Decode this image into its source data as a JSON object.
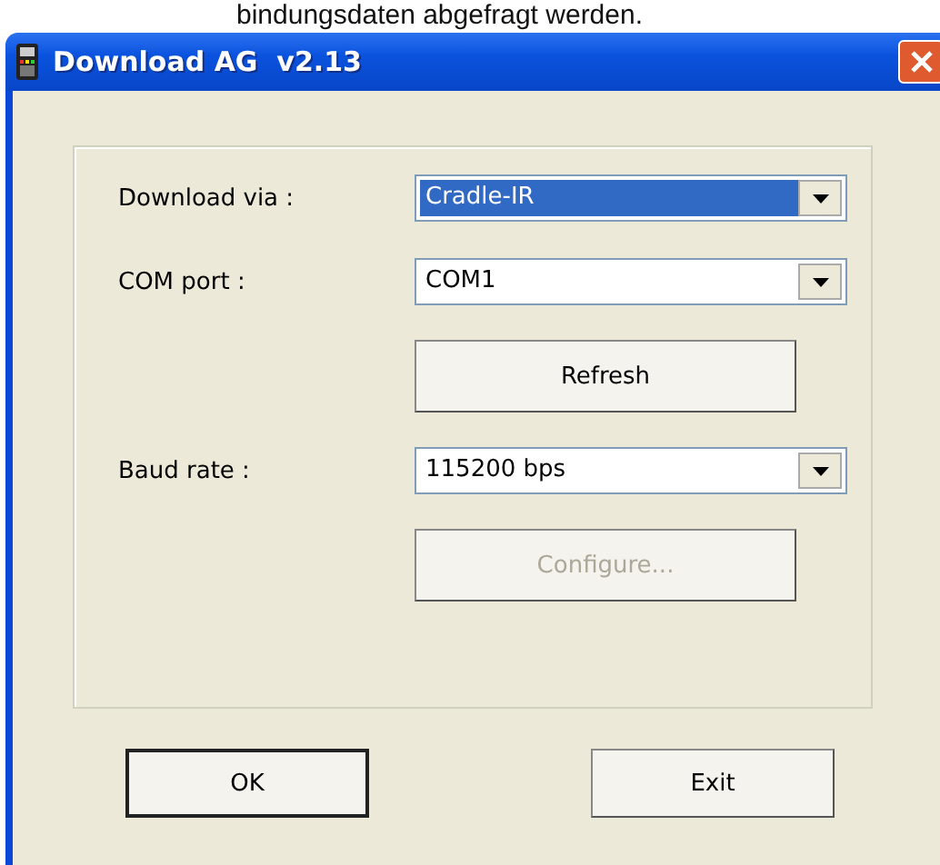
{
  "background_text": "bindungsdaten abgefragt werden.",
  "window": {
    "title": "Download AG  v2.13"
  },
  "rows": [
    {
      "kind": "combo",
      "label": "Download via :",
      "value": "Cradle-IR",
      "selected": true
    },
    {
      "kind": "combo",
      "label": "COM port :",
      "value": "COM1",
      "selected": false
    },
    {
      "kind": "button",
      "label": "Refresh",
      "disabled": false
    },
    {
      "kind": "combo",
      "label": "Baud rate :",
      "value": "115200 bps",
      "selected": false
    },
    {
      "kind": "button",
      "label": "Configure...",
      "disabled": true
    }
  ],
  "buttons": [
    {
      "label": "OK",
      "default": true
    },
    {
      "label": "Exit",
      "default": false
    }
  ]
}
